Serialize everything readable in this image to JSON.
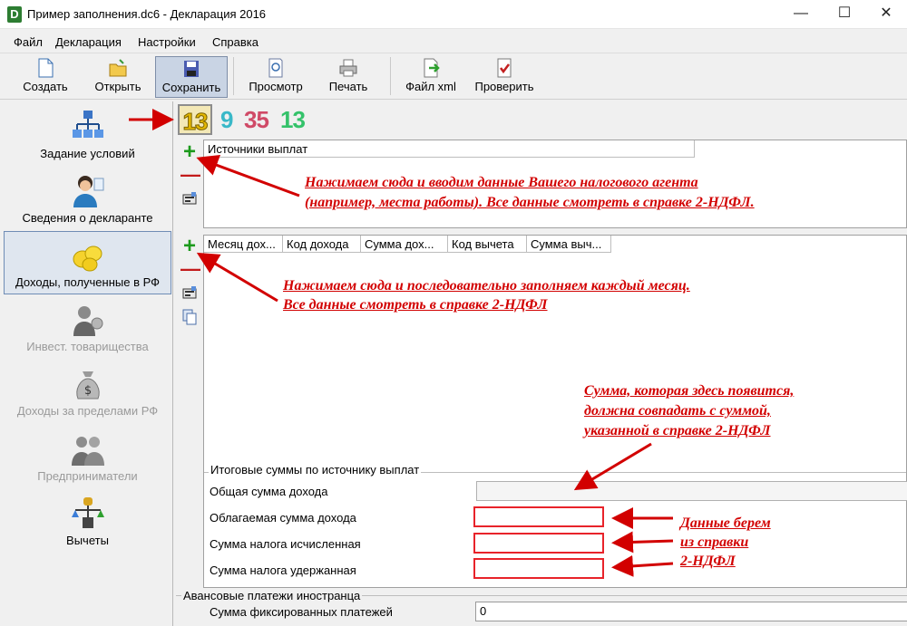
{
  "window": {
    "title": "Пример заполнения.dc6 - Декларация 2016",
    "app_letter": "D",
    "minimize": "—",
    "maximize": "☐",
    "close": "✕"
  },
  "menu": [
    "Файл",
    "Декларация",
    "Настройки",
    "Справка"
  ],
  "toolbar": {
    "create": "Создать",
    "open": "Открыть",
    "save": "Сохранить",
    "preview": "Просмотр",
    "print": "Печать",
    "xml": "Файл xml",
    "check": "Проверить"
  },
  "nav": [
    {
      "label": "Задание условий",
      "icon": "conditions-tree-icon"
    },
    {
      "label": "Сведения о декларанте",
      "icon": "declarant-person-icon"
    },
    {
      "label": "Доходы, полученные в РФ",
      "icon": "coins-icon"
    },
    {
      "label": "Инвест. товарищества",
      "icon": "investor-icon"
    },
    {
      "label": "Доходы за пределами РФ",
      "icon": "money-bag-icon"
    },
    {
      "label": "Предприниматели",
      "icon": "entrepreneurs-icon"
    },
    {
      "label": "Вычеты",
      "icon": "deductions-scales-icon"
    }
  ],
  "rate_tabs": [
    {
      "label": "13",
      "color": "#e5b800"
    },
    {
      "label": "9",
      "color": "#39b8c8"
    },
    {
      "label": "35",
      "color": "#d04a67"
    },
    {
      "label": "13",
      "color": "#34c26a"
    }
  ],
  "sources_panel": {
    "header": "Источники выплат"
  },
  "months_panel": {
    "headers": [
      "Месяц дох...",
      "Код дохода",
      "Сумма дох...",
      "Код вычета",
      "Сумма выч..."
    ]
  },
  "totals": {
    "group_title": "Итоговые суммы по источнику выплат",
    "total_income": "Общая сумма дохода",
    "taxable_income": "Облагаемая сумма дохода",
    "tax_calculated": "Сумма налога исчисленная",
    "tax_withheld": "Сумма налога удержанная"
  },
  "advance": {
    "group_title": "Авансовые платежи иностранца",
    "fixed_label": "Сумма фиксированных платежей",
    "fixed_value": "0"
  },
  "annotations": {
    "a1_line1": "Нажимаем сюда и вводим данные Вашего налогового агента",
    "a1_line2": "(например, места работы). Все данные смотреть в справке 2-НДФЛ.",
    "a2_line1": "Нажимаем сюда и последовательно заполняем каждый месяц.",
    "a2_line2": "Все данные смотреть в справке 2-НДФЛ",
    "a3_line1": "Сумма, которая здесь появится,",
    "a3_line2": "должна совпадать с суммой,",
    "a3_line3": "указанной в справке 2-НДФЛ",
    "a4_line1": "Данные берем",
    "a4_line2": "из справки",
    "a4_line3": "2-НДФЛ"
  },
  "colors": {
    "annotation_red": "#d20000",
    "selected_blue": "#c9d4e4"
  }
}
